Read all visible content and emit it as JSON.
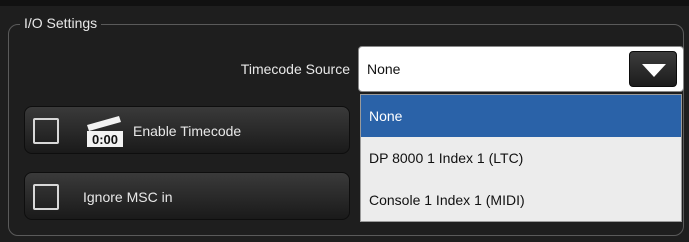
{
  "io_settings": {
    "group_title": "I/O Settings",
    "timecode_source": {
      "label": "Timecode Source",
      "selected_value": "None",
      "options": [
        "None",
        "DP 8000 1 Index 1 (LTC)",
        "Console 1 Index 1 (MIDI)"
      ]
    },
    "enable_timecode": {
      "label": "Enable Timecode",
      "checked": false,
      "icon": "clapperboard-timecode-icon",
      "icon_text": "0:00"
    },
    "ignore_msc_in": {
      "label": "Ignore MSC in",
      "checked": false
    }
  },
  "colors": {
    "background": "#1e1e1e",
    "selected_option": "#2a62a8",
    "button_gradient_top": "#3a3a3a",
    "button_gradient_bottom": "#1a1a1a"
  }
}
